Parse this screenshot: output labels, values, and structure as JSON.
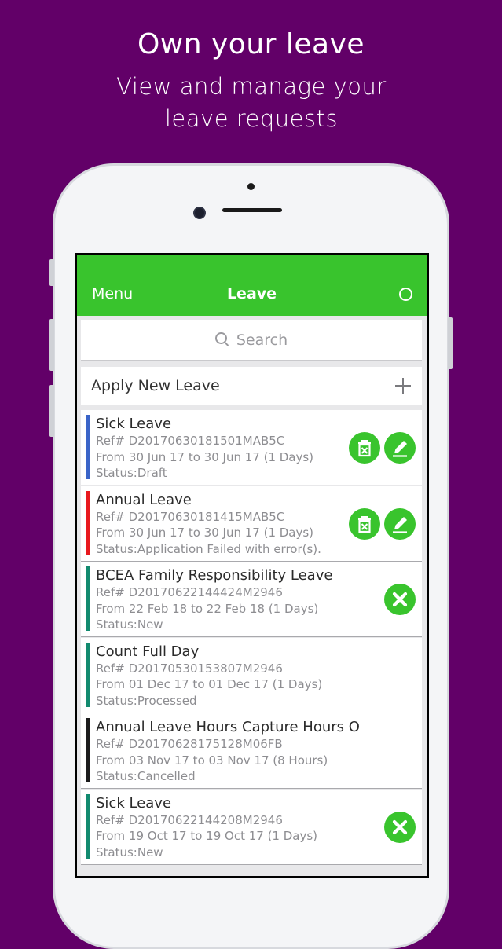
{
  "hero": {
    "title": "Own your leave",
    "subtitle_line1": "View and manage your",
    "subtitle_line2": "leave requests"
  },
  "navbar": {
    "menu_label": "Menu",
    "title": "Leave"
  },
  "search": {
    "placeholder": "Search"
  },
  "apply": {
    "label": "Apply New Leave"
  },
  "colors": {
    "background": "#620068",
    "navbar": "#39c42d",
    "draft": "#3a64c8",
    "failed": "#e8191e",
    "teal": "#128a6f",
    "cancelled": "#1c1c1c"
  },
  "leaves": [
    {
      "title": "Sick Leave",
      "ref": "Ref# D20170630181501MAB5C",
      "period": "From 30 Jun 17 to 30 Jun 17 (1 Days)",
      "status": "Status:Draft",
      "bar_color": "#3a64c8",
      "actions": [
        "delete-icon",
        "edit-icon"
      ]
    },
    {
      "title": "Annual Leave",
      "ref": "Ref# D20170630181415MAB5C",
      "period": "From 30 Jun 17 to 30 Jun 17 (1 Days)",
      "status": "Status:Application Failed with error(s).",
      "bar_color": "#e8191e",
      "actions": [
        "delete-icon",
        "edit-icon"
      ]
    },
    {
      "title": "BCEA Family Responsibility Leave",
      "ref": "Ref# D20170622144424M2946",
      "period": "From 22 Feb 18 to 22 Feb 18 (1 Days)",
      "status": "Status:New",
      "bar_color": "#128a6f",
      "actions": [
        "cancel-icon"
      ]
    },
    {
      "title": "Count Full Day",
      "ref": "Ref# D20170530153807M2946",
      "period": "From 01 Dec 17 to 01 Dec 17 (1 Days)",
      "status": "Status:Processed",
      "bar_color": "#128a6f",
      "actions": []
    },
    {
      "title": "Annual Leave Hours Capture Hours O",
      "ref": "Ref# D20170628175128M06FB",
      "period": "From 03 Nov 17 to 03 Nov 17 (8 Hours)",
      "status": "Status:Cancelled",
      "bar_color": "#1c1c1c",
      "actions": []
    },
    {
      "title": "Sick Leave",
      "ref": "Ref# D20170622144208M2946",
      "period": "From 19 Oct 17 to 19 Oct 17 (1 Days)",
      "status": "Status:New",
      "bar_color": "#128a6f",
      "actions": [
        "cancel-icon"
      ]
    }
  ]
}
